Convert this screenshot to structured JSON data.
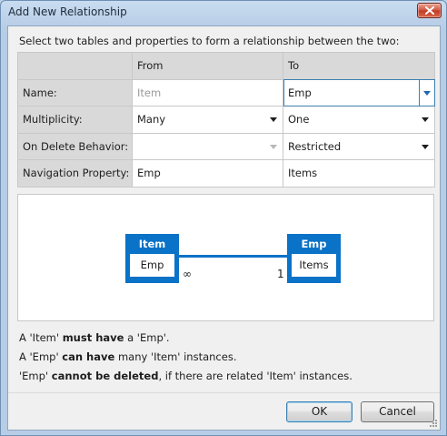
{
  "window": {
    "title": "Add New Relationship",
    "close_icon": "close-x-icon"
  },
  "instructions": "Select two tables and properties to form a relationship between the two:",
  "grid": {
    "headers": {
      "corner": "",
      "from": "From",
      "to": "To"
    },
    "rows": [
      {
        "label": "Name:",
        "from": "Item",
        "to": "Emp"
      },
      {
        "label": "Multiplicity:",
        "from": "Many",
        "to": "One"
      },
      {
        "label": "On Delete Behavior:",
        "from": "",
        "to": "Restricted"
      },
      {
        "label": "Navigation Property:",
        "from": "Emp",
        "to": "Items"
      }
    ]
  },
  "diagram": {
    "left_entity": {
      "name": "Item",
      "property": "Emp"
    },
    "right_entity": {
      "name": "Emp",
      "property": "Items"
    },
    "left_multiplicity": "∞",
    "right_multiplicity": "1"
  },
  "descriptions": {
    "line1": {
      "a": "A 'Item' ",
      "b": "must have",
      "c": " a 'Emp'."
    },
    "line2": {
      "a": "A 'Emp' ",
      "b": "can have",
      "c": " many 'Item' instances."
    },
    "line3": {
      "a": "'Emp' ",
      "b": "cannot be deleted",
      "c": ", if there are related 'Item' instances."
    }
  },
  "buttons": {
    "ok": "OK",
    "cancel": "Cancel"
  },
  "colors": {
    "entity": "#0a72c7",
    "accent": "#3c7fb1"
  }
}
